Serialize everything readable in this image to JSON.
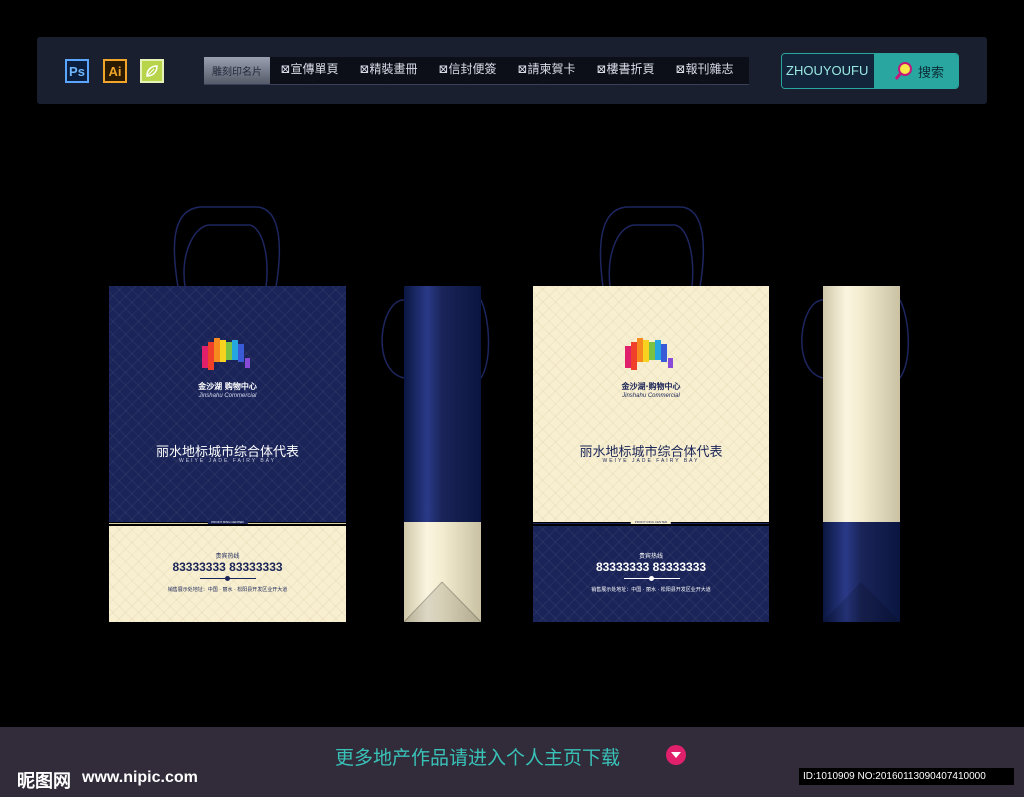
{
  "toolbar": {
    "icons": [
      {
        "name": "photoshop-icon",
        "label": "Ps",
        "color": "#5aa6ff"
      },
      {
        "name": "illustrator-icon",
        "label": "Ai",
        "color": "#f0a52a"
      },
      {
        "name": "leaf-icon",
        "label": "",
        "color": "#b7d44a"
      }
    ]
  },
  "nav": {
    "active_tab": "雕刻印名片",
    "items": [
      {
        "label": "⊠宣傳單頁"
      },
      {
        "label": "⊠精裝畫冊"
      },
      {
        "label": "⊠信封便簽"
      },
      {
        "label": "⊠請柬賀卡"
      },
      {
        "label": "⊠樓書折頁"
      },
      {
        "label": "⊠報刊雜志"
      }
    ]
  },
  "search": {
    "value": "ZHOUYOUFU",
    "button_label": "搜索"
  },
  "bags": {
    "brand_cn_navy": "金沙湖 购物中心",
    "brand_cn_cream": "金沙湖·购物中心",
    "brand_en": "Jinshahu Commercial",
    "slogan_cn": "丽水地标城市综合体代表",
    "slogan_en": "WEIYE JADE FAIRY BAY",
    "band_label": "PROFIT RING CENTER",
    "hotline_label": "贵宾热线",
    "phone": "83333333 83333333",
    "address": "销售展示处地址：中国 · 丽水 · 松阳县开发区业开大道",
    "colors": {
      "navy": "#1a2458",
      "cream": "#f7efd0"
    }
  },
  "footer": {
    "promo_text": "更多地产作品请进入个人主页下载",
    "watermark_cn": "昵图网",
    "watermark_url": "www.nipic.com",
    "id_text": "ID:1010909 NO:20160113090407410000"
  }
}
